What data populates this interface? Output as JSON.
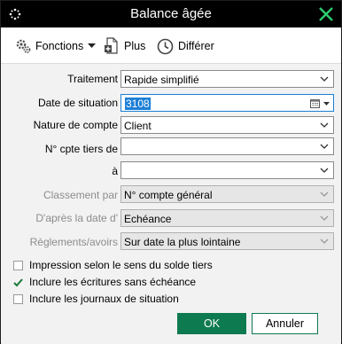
{
  "window": {
    "title": "Balance âgée"
  },
  "titlebar": {
    "app_icon": "dots-icon",
    "close_icon": "close-icon",
    "close_color": "#2ecc71"
  },
  "toolbar": {
    "functions_label": "Fonctions",
    "plus_label": "Plus",
    "defer_label": "Différer"
  },
  "form": {
    "traitement": {
      "label": "Traitement",
      "value": "Rapide simplifié"
    },
    "date_situation": {
      "label": "Date de situation",
      "value": "3108"
    },
    "nature_compte": {
      "label": "Nature de compte",
      "value": "Client"
    },
    "cpte_tiers_de": {
      "label": "N° cpte tiers de",
      "value": ""
    },
    "cpte_tiers_a": {
      "label": "à",
      "value": ""
    },
    "classement": {
      "label": "Classement par",
      "value": "N° compte général"
    },
    "apres_date": {
      "label": "D'après la date d'",
      "value": "Echéance"
    },
    "reglements": {
      "label": "Règlements/avoirs",
      "value": "Sur date la plus lointaine"
    }
  },
  "options": [
    {
      "label": "Impression selon le sens du solde tiers",
      "checked": false
    },
    {
      "label": "Inclure les écritures sans échéance",
      "checked": true
    },
    {
      "label": "Inclure les journaux de situation",
      "checked": false
    }
  ],
  "buttons": {
    "ok": "OK",
    "cancel": "Annuler",
    "ok_color": "#0e7a4f"
  }
}
